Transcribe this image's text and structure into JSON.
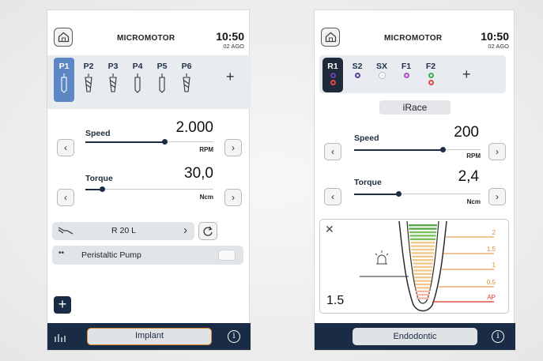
{
  "left": {
    "title": "MICROMOTOR",
    "time": "10:50",
    "date": "02 AGO",
    "programs": [
      "P1",
      "P2",
      "P3",
      "P4",
      "P5",
      "P6"
    ],
    "add_label": "+",
    "speed": {
      "label": "Speed",
      "value": "2.000",
      "unit": "RPM",
      "level": 0.62
    },
    "torque": {
      "label": "Torque",
      "value": "30,0",
      "unit": "Ncm",
      "level": 0.13
    },
    "handpiece": {
      "label": "R 20 L"
    },
    "pump": {
      "label": "Peristaltic Pump",
      "on": false
    },
    "fab_label": "+",
    "mode_button": "Implant",
    "info": "i",
    "icons": [
      "home-icon",
      "drill-icon",
      "prev-icon",
      "next-icon",
      "handpiece-icon",
      "rotate-icon",
      "drops-icon",
      "stats-icon",
      "info-icon"
    ]
  },
  "right": {
    "title": "MICROMOTOR",
    "time": "10:50",
    "date": "02 AGO",
    "programs": [
      {
        "label": "R1",
        "colors": [
          "#6b3fb0",
          "#e0484b"
        ]
      },
      {
        "label": "S2",
        "colors": [
          "#5b3ea0"
        ]
      },
      {
        "label": "SX",
        "colors": [
          "#ffffff"
        ]
      },
      {
        "label": "F1",
        "colors": [
          "#b44cc9"
        ]
      },
      {
        "label": "F2",
        "colors": [
          "#3fae57",
          "#e0484b"
        ]
      }
    ],
    "add_label": "+",
    "file_name": "iRace",
    "speed": {
      "label": "Speed",
      "value": "200",
      "unit": "RPM",
      "level": 0.7
    },
    "torque": {
      "label": "Torque",
      "value": "2,4",
      "unit": "Ncm",
      "level": 0.35
    },
    "apex": {
      "reading": "1.5",
      "scale": [
        "2",
        "1.5",
        "1",
        "0.5",
        "AP"
      ],
      "close_label": "✕"
    },
    "mode_button": "Endodontic",
    "info": "i",
    "colors": {
      "navy": "#1a2b45",
      "accent_orange": "#e08a2c",
      "apex_red": "#d9342b",
      "bar_green": "#5aa84a"
    }
  }
}
